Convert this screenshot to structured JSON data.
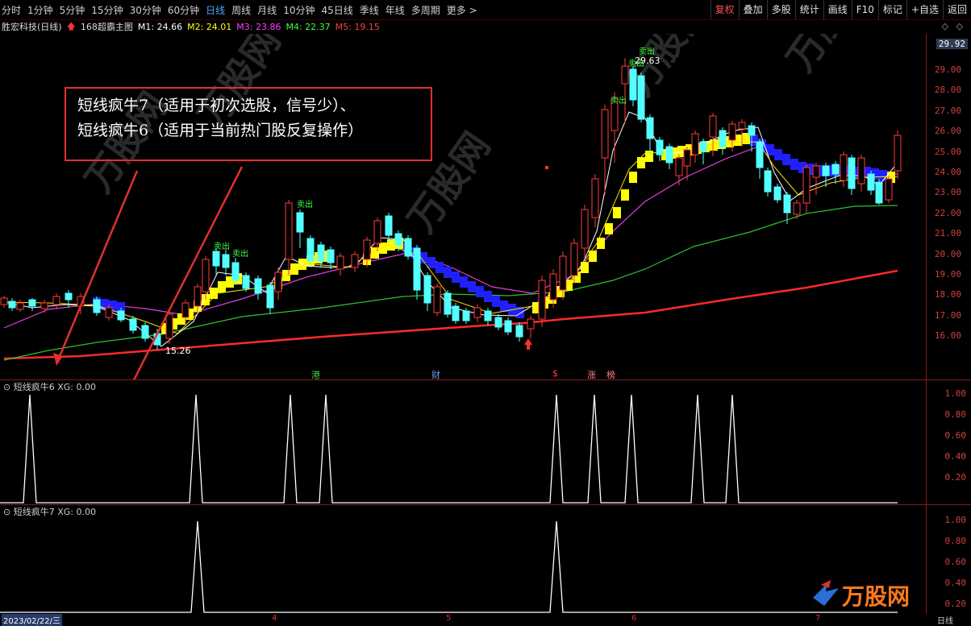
{
  "toolbar": {
    "left_items": [
      "分时",
      "1分钟",
      "5分钟",
      "15分钟",
      "30分钟",
      "60分钟",
      "日线",
      "周线",
      "月线",
      "10分钟",
      "45日线",
      "季线",
      "年线",
      "多周期",
      "更多 >"
    ],
    "active": "日线",
    "right_items": [
      "复权",
      "叠加",
      "多股",
      "统计",
      "画线",
      "F10",
      "标记",
      "+自选",
      "返回"
    ]
  },
  "infobar": {
    "stock": "胜宏科技(日线)",
    "indicator": "168超霸主图",
    "ma": [
      {
        "label": "M1: 24.66",
        "color": "#ffffff"
      },
      {
        "label": "M2: 24.01",
        "color": "#ffff00"
      },
      {
        "label": "M3: 23.86",
        "color": "#ff40ff"
      },
      {
        "label": "M4: 22.37",
        "color": "#40ff40"
      },
      {
        "label": "M5: 19.15",
        "color": "#ff4040"
      }
    ],
    "arrow_icon": "up-arrow-icon"
  },
  "price_axis": {
    "current": "29.92",
    "ticks": [
      "29.00",
      "28.00",
      "27.00",
      "26.00",
      "25.00",
      "24.00",
      "23.00",
      "22.00",
      "21.00",
      "20.00",
      "19.00",
      "18.00",
      "17.00",
      "16.00"
    ]
  },
  "annotation": {
    "line1": "短线疯牛7（适用于初次选股，信号少）、",
    "line2": "短线疯牛6（适用于当前热门股反复操作）"
  },
  "chart_labels": {
    "high": "29.63",
    "low": "15.26",
    "sell": "卖出"
  },
  "news_markers": [
    {
      "text": "港",
      "color": "#40d040"
    },
    {
      "text": "财",
      "color": "#6aa0ff"
    },
    {
      "text": "$",
      "color": "#ff4040"
    },
    {
      "text": "涨",
      "color": "#ff8080"
    },
    {
      "text": "榜",
      "color": "#ff8080"
    }
  ],
  "panel6": {
    "label": "短线疯牛6 XG: 0.00",
    "ticks": [
      "1.00",
      "0.80",
      "0.60",
      "0.40",
      "0.20"
    ]
  },
  "panel7": {
    "label": "短线疯牛7 XG: 0.00",
    "ticks": [
      "1.00",
      "0.80",
      "0.60",
      "0.40",
      "0.20"
    ]
  },
  "date_bar": {
    "date": "2023/02/22/三",
    "months": [
      "4",
      "5",
      "6",
      "7"
    ],
    "period": "日线"
  },
  "watermark": "万股网",
  "chart_data": [
    {
      "type": "line",
      "title": "短线疯牛6 XG",
      "series": [
        {
          "values": [
            0,
            0,
            1,
            0,
            0,
            1,
            0,
            0,
            1,
            1,
            0,
            0,
            0,
            0,
            0,
            0,
            0,
            1,
            1,
            1,
            0,
            1,
            1,
            0,
            0,
            0
          ]
        }
      ],
      "ylim": [
        0,
        1
      ]
    },
    {
      "type": "line",
      "title": "短线疯牛7 XG",
      "series": [
        {
          "values": [
            0,
            0,
            0,
            0,
            1,
            0,
            0,
            0,
            0,
            0,
            0,
            0,
            0,
            0,
            1,
            0,
            0,
            0
          ]
        }
      ],
      "ylim": [
        0,
        1
      ]
    }
  ]
}
